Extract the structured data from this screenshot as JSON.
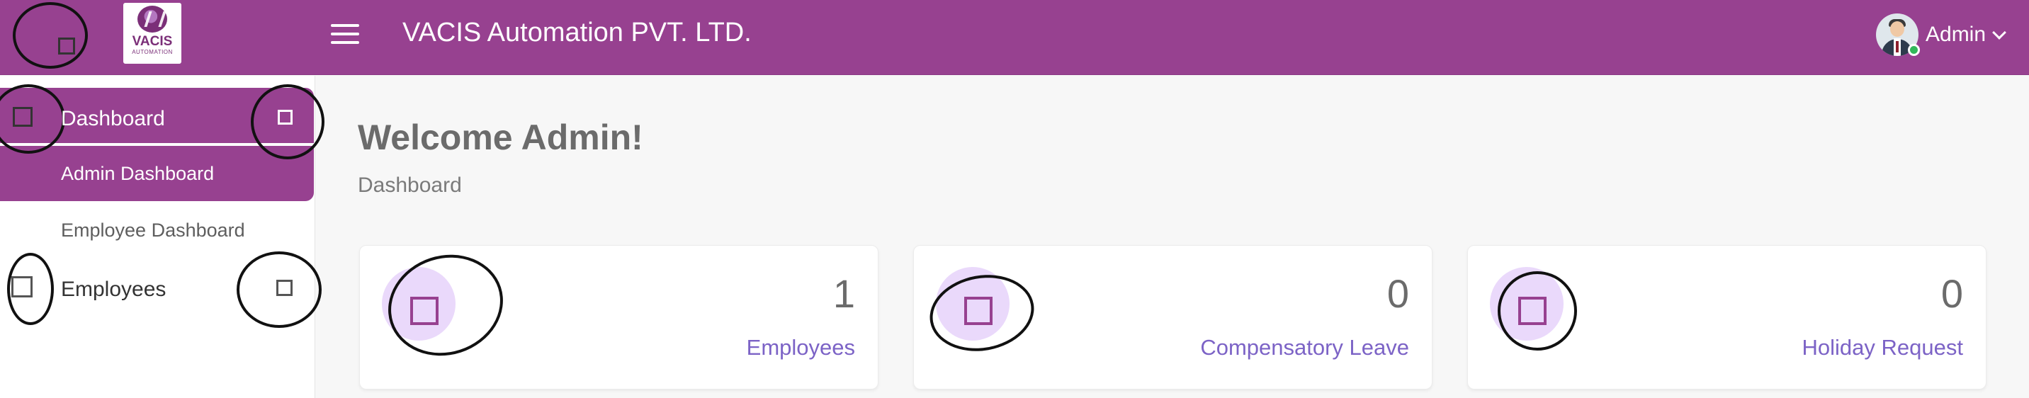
{
  "header": {
    "company_name": "VACIS Automation PVT. LTD.",
    "logo": {
      "text": "VACIS",
      "subtext": "AUTOMATION"
    },
    "icons": {
      "brand_placeholder": "square-icon",
      "menu_toggle": "hamburger-icon",
      "user_dropdown": "chevron-down-icon"
    },
    "user": {
      "name": "Admin",
      "status": "online"
    }
  },
  "sidebar": {
    "items": [
      {
        "label": "Dashboard",
        "active": true,
        "icon": "square-icon",
        "expand_icon": "square-icon",
        "children": [
          {
            "label": "Admin Dashboard",
            "active": true
          },
          {
            "label": "Employee Dashboard",
            "active": false
          }
        ]
      },
      {
        "label": "Employees",
        "active": false,
        "icon": "square-icon",
        "expand_icon": "square-icon"
      }
    ]
  },
  "main": {
    "title": "Welcome Admin!",
    "breadcrumb": "Dashboard",
    "cards": [
      {
        "value": "1",
        "label": "Employees",
        "icon": "square-icon"
      },
      {
        "value": "0",
        "label": "Compensatory Leave",
        "icon": "square-icon"
      },
      {
        "value": "0",
        "label": "Holiday Request",
        "icon": "square-icon"
      }
    ]
  },
  "colors": {
    "brand_purple": "#974190",
    "icon_bg": "#ead9fb",
    "card_label": "#7c63c6",
    "background": "#f7f7f7",
    "online": "#31b85a"
  }
}
